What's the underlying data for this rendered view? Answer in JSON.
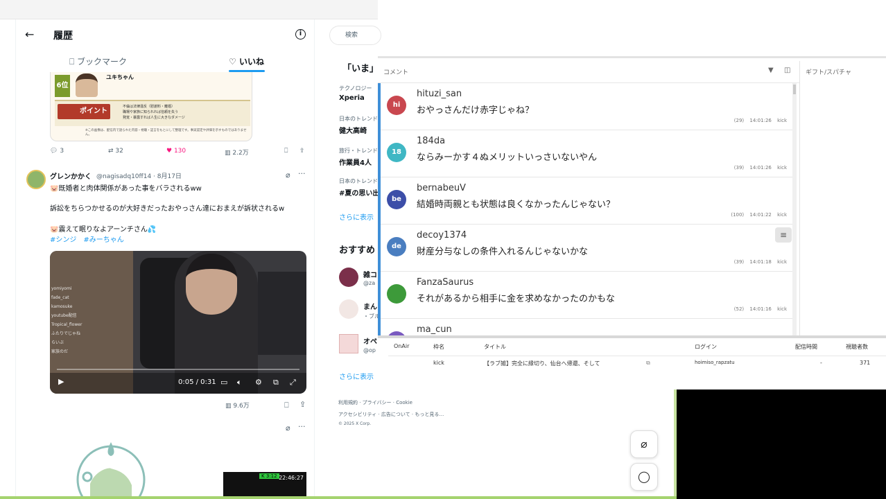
{
  "history": {
    "title": "履歴",
    "tabs": [
      {
        "label": "ブックマーク"
      },
      {
        "label": "いいね"
      }
    ]
  },
  "card": {
    "rank": "6位",
    "name": "ユキちゃん",
    "point_label": "ポイント",
    "point_lines": [
      "不倫は法律違反（慰謝料・離婚）",
      "職場や家族に知られれば信頼を失う",
      "発覚・暴露すれば人生に大きなダメージ"
    ],
    "footer": "※この画像は、配信内で語られた内容・視聴・証言をもとにして整理です。事実認定や評価を示すものではありません。"
  },
  "post1_stats": {
    "replies": "3",
    "retweets": "32",
    "likes": "130",
    "views": "2.2万"
  },
  "post2": {
    "author": "グレンかかく",
    "handle": "@nagisadq10ff14 · 8月17日",
    "line1": "🐷既婚者と肉体関係があった事をバラされるww",
    "line2": "訴訟をちらつかせるのが大好きだったおやっさん達におまえが訴状されるw",
    "line3": "🐷震えて眠りなよアーンチさん💦",
    "hashtags": "#シンジ　#みーちゃん",
    "video_time": "0:05 / 0:31",
    "views": "9.6万",
    "video_chat": [
      "yomiyomi",
      "fade_cat",
      "kamosuke",
      "youtube配信",
      "Tropical_flower",
      "ふたりでじゃね",
      "らいぶ",
      "家族のだ"
    ]
  },
  "mini_video": {
    "badge": "K 3:12",
    "time": "22:46:27"
  },
  "search": {
    "placeholder": "検索"
  },
  "trends": {
    "heading": "「いま」",
    "items": [
      {
        "category": "テクノロジー",
        "name": "Xperia"
      },
      {
        "category": "日本のトレンド",
        "name": "健大高崎"
      },
      {
        "category": "旅行・トレンド",
        "name": "作業員4人"
      },
      {
        "category": "日本のトレンド",
        "name": "#夏の思い出"
      }
    ],
    "more": "さらに表示"
  },
  "recommend": {
    "heading": "おすすめ",
    "users": [
      {
        "name": "雑コ",
        "handle": "@za"
      },
      {
        "name": "まん",
        "handle": "・ブル"
      },
      {
        "name": "オペ",
        "handle": "@op"
      }
    ],
    "more": "さらに表示"
  },
  "footer_links": {
    "row1": "利用規約 · プライバシー · Cookie",
    "row2": "アクセシビリティ · 広告について · もっと見る…",
    "row3": "© 2025 X Corp."
  },
  "comments_panel": {
    "header": "コメント",
    "gift_header": "ギフト/スパチャ",
    "rows": [
      {
        "initials": "hi",
        "color": "#c9474f",
        "user": "hituzi_san",
        "text": "おやっさんだけ赤字じゃね？",
        "count": "(29)",
        "time": "14:01:26",
        "source": "kick"
      },
      {
        "initials": "18",
        "color": "#3fb7c4",
        "user": "184da",
        "text": "ならみーかす４ぬメリットいっさいないやん",
        "count": "(39)",
        "time": "14:01:26",
        "source": "kick"
      },
      {
        "initials": "be",
        "color": "#3c4ea8",
        "user": "bernabeuV",
        "text": "結婚時両親とも状態は良くなかったんじゃない？",
        "count": "(100)",
        "time": "14:01:22",
        "source": "kick"
      },
      {
        "initials": "de",
        "color": "#4a7ec0",
        "user": "decoy1374",
        "text": "財産分与なしの条件入れるんじゃないかな",
        "count": "(39)",
        "time": "14:01:18",
        "source": "kick"
      },
      {
        "initials": "",
        "color": "#3d9a3a",
        "user": "FanzaSaurus",
        "text": "それがあるから相手に金を求めなかったのかもな",
        "count": "(52)",
        "time": "14:01:16",
        "source": "kick"
      },
      {
        "initials": "",
        "color": "#7a5ac0",
        "user": "ma_cun",
        "text": "",
        "count": "",
        "time": "",
        "source": ""
      }
    ]
  },
  "stream_table": {
    "headers": [
      "OnAir",
      "枠名",
      "タイトル",
      "ログイン",
      "配信時間",
      "視聴者数"
    ],
    "row": {
      "platform": "kick",
      "title": "【ラブ雑】完全に縁切り、仙台へ帰還、そして",
      "login": "hoimiso_rapzatu",
      "duration": "-",
      "viewers": "371"
    }
  }
}
